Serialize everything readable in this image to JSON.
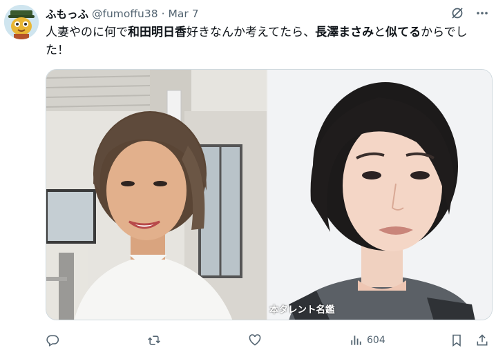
{
  "tweet": {
    "author_name": "ふもっふ",
    "author_handle": "@fumoffu38",
    "separator": "·",
    "date": "Mar 7",
    "text_parts": {
      "p1": "人妻やのに何で",
      "b1": "和田明日香",
      "p2": "好きなんか考えてたら、",
      "b2": "長澤まさみ",
      "p3": "と",
      "b3": "似てる",
      "p4": "からでした！"
    }
  },
  "media": {
    "watermark": "本タレント名鑑"
  },
  "actions": {
    "views_count": "604"
  },
  "icons": {
    "header": [
      "grok-icon",
      "more-icon"
    ],
    "actions": [
      "reply-icon",
      "retweet-icon",
      "like-icon",
      "views-icon",
      "bookmark-icon",
      "share-icon"
    ]
  },
  "colors": {
    "text": "#0f1419",
    "secondary": "#536471",
    "border": "#cfd9de"
  }
}
